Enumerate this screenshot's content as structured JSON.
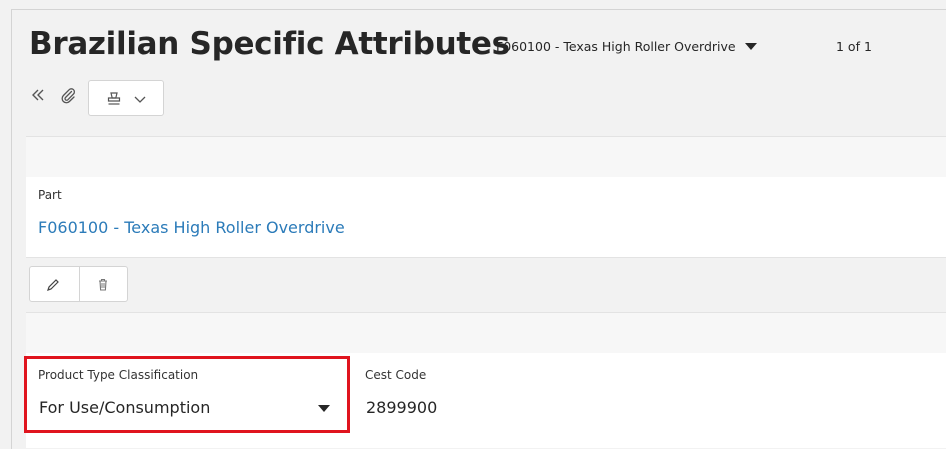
{
  "header": {
    "title": "Brazilian Specific Attributes",
    "record_selector": "F060100 - Texas High Roller Overdrive",
    "record_count": "1 of 1"
  },
  "part_section": {
    "label": "Part",
    "value": "F060100 - Texas High Roller Overdrive"
  },
  "attributes_section": {
    "product_type_label": "Product Type Classification",
    "product_type_value": "For Use/Consumption",
    "cest_label": "Cest Code",
    "cest_value": "2899900"
  },
  "icons": {
    "collapse": "double-chevron-left-icon",
    "attachment": "paperclip-icon",
    "actions": "stamp-icon",
    "edit": "pencil-icon",
    "delete": "trash-icon"
  },
  "colors": {
    "link": "#2b7bb9",
    "highlight": "#e0141e",
    "background": "#f2f2f2"
  }
}
